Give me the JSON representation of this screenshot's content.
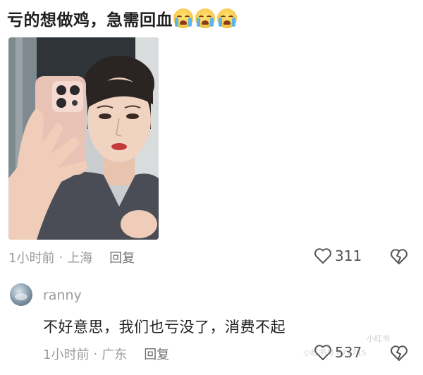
{
  "post": {
    "text": "亏的想做鸡，急需回血",
    "emojis": [
      "crying-face-icon",
      "crying-face-icon",
      "crying-face-icon"
    ],
    "time": "1小时前",
    "location": "上海",
    "reply_label": "回复",
    "likes": "311"
  },
  "reply": {
    "username": "ranny",
    "text": "不好意思，我们也亏没了，消费不起",
    "time": "1小时前",
    "location": "广东",
    "reply_label": "回复",
    "likes": "537"
  },
  "colors": {
    "text_primary": "#1f1f1f",
    "text_secondary": "#9a9a9a",
    "emoji_yellow": "#f6b92a",
    "tear_blue": "#55b6f2"
  },
  "watermark": {
    "badge": "小红书",
    "text": "小红书号 877715"
  }
}
